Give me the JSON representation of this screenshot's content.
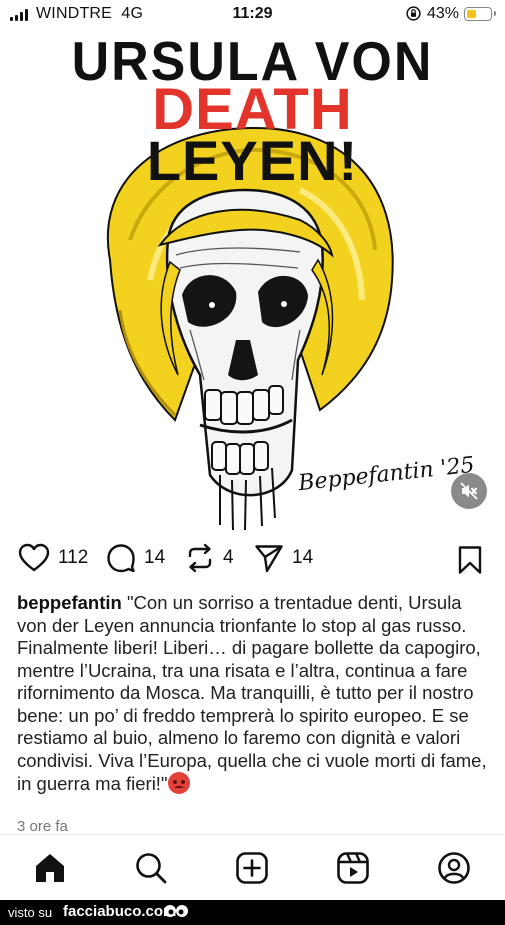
{
  "status_bar": {
    "carrier": "WINDTRE",
    "network": "4G",
    "time": "11:29",
    "battery_percent": "43%",
    "battery_level": 0.43,
    "battery_color": "#f6c21a"
  },
  "post": {
    "image": {
      "title_line1": "URSULA VON",
      "title_line2": "DEATH",
      "title_line3": "LEYEN!",
      "signature": "Beppefantin '25",
      "accent_color": "#e3342c",
      "hair_color": "#f2d21e"
    },
    "actions": {
      "likes": "112",
      "comments": "14",
      "reposts": "4",
      "shares": "14"
    },
    "caption": {
      "username": "beppefantin",
      "text": "\"Con un sorriso a trentadue denti, Ursula von der Leyen annuncia trionfante lo stop al gas russo. Finalmente liberi! Liberi… di pagare bollette da capogiro, mentre l’Ucraina, tra una risata e l’altra, continua a fare rifornimento da Mosca. Ma tranquilli, è tutto per il nostro bene: un po’ di freddo temprerà lo spirito europeo. E se restiamo al buio, almeno lo faremo con dignità e valori condivisi. Viva l’Europa, quella che ci vuole morti di fame, in guerra ma fieri!\"",
      "emoji": "angry-face"
    },
    "timestamp": "3 ore fa"
  },
  "bottom_nav": [
    "home-icon",
    "search-icon",
    "create-icon",
    "reels-icon",
    "profile-icon"
  ],
  "footer": {
    "visto_su": "visto su",
    "brand": "facciabuco.com"
  }
}
